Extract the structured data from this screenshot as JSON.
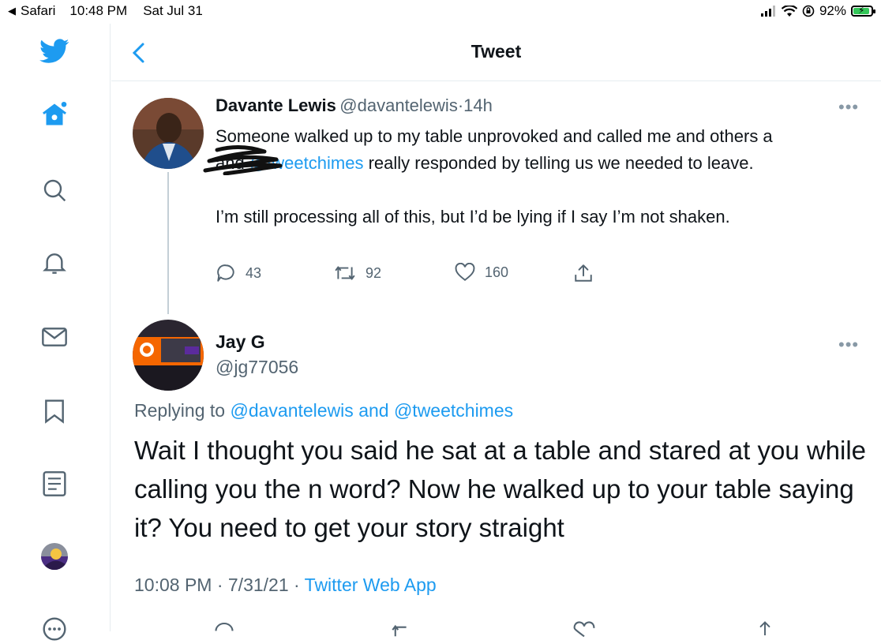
{
  "status_bar": {
    "back_app": "Safari",
    "time": "10:48 PM",
    "date": "Sat Jul 31",
    "battery_percent": "92%",
    "battery_level": 0.92
  },
  "nav": {
    "items": [
      "twitter-logo-icon",
      "home-icon",
      "search-icon",
      "notifications-icon",
      "messages-icon",
      "bookmarks-icon",
      "lists-icon",
      "profile-avatar",
      "more-icon"
    ],
    "accent": "#1d9bf0"
  },
  "header": {
    "title": "Tweet"
  },
  "tweet": {
    "name": "Davante Lewis",
    "handle": "@davantelewis",
    "time": "14h",
    "text_line1": "Someone walked up to my table unprovoked and called me and others a",
    "text_and": "and",
    "text_mention": "@tweetchimes",
    "text_rest": "really responded by telling us we needed to leave.",
    "text_para2": "I’m still processing all of this, but I’d be lying if I say I’m not shaken.",
    "replies": "43",
    "retweets": "92",
    "likes": "160"
  },
  "reply": {
    "name": "Jay G",
    "handle": "@jg77056",
    "replying_label": "Replying to",
    "replying_user1": "@davantelewis",
    "replying_and": "and",
    "replying_user2": "@tweetchimes",
    "text": "Wait I thought you said he sat at a table and stared at you while calling you the n word? Now he walked up to your table saying it? You need to get your story straight",
    "timestamp": "10:08 PM · 7/31/21",
    "source": "Twitter Web App"
  }
}
